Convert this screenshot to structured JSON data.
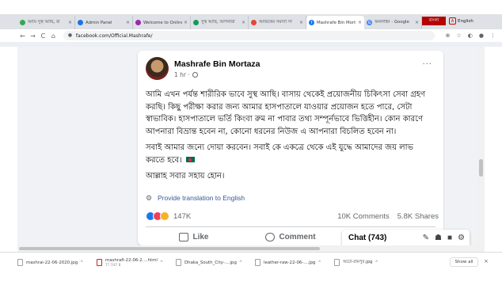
{
  "browser": {
    "tabs": [
      {
        "label": "আমি সুস্থ আছি, বা",
        "color": "#34a853"
      },
      {
        "label": "Admin Panel",
        "color": "#1a73e8"
      },
      {
        "label": "Welcome to OnlineNews",
        "color": "#9c27b0"
      },
      {
        "label": "সুস্থ আছি, আপনারা",
        "color": "#0f9d58"
      },
      {
        "label": "আজকের সমস্যা সা",
        "color": "#ea4335"
      },
      {
        "label": "Mashrafe Bin Mort",
        "color": "#1877f2",
        "active": true
      },
      {
        "label": "অনলাইন - Google",
        "color": "#4285f4"
      }
    ],
    "tab_close": "×",
    "new_tab": "+",
    "lang_badge": "বাংলা",
    "lang_icon": "A",
    "lang_label": "English",
    "nav": {
      "back": "←",
      "forward": "→",
      "reload": "C",
      "home": "⌂"
    },
    "url": "facebook.com/Official.Mashrafe/",
    "addr_icons": {
      "zoom": "⊕",
      "star": "☆",
      "ext": "◐",
      "account": "●",
      "menu": "⋮"
    }
  },
  "post": {
    "author": "Mashrafe Bin Mortaza",
    "time": "1 hr ·",
    "more": "···",
    "paragraphs": [
      "আমি এখন পর্যন্ত শারীরিক ভাবে সুস্থ আছি। বাসায় থেকেই প্রয়োজনীয় চিকিৎসা সেবা গ্রহণ করছি। কিছু পরীক্ষা করার জন্য আমার হাসপাতালে যাওয়ার প্রয়োজন হতে পারে, সেটা স্বাভাবিক। হাসপাতালে ভর্তি কিংবা রুম না পাবার তথ্য সম্পূর্নভাবে ভিত্তিহীন। কোন কারণে আপনারা বিভ্রান্ত হবেন না, কোনো ধরনের নিউজ এ আপনারা বিচলিত হবেন না।",
      "সবাই আমার জন্যে দোয়া করবেন। সবাই কে একত্রে থেকে এই যুদ্ধে আমাদের জয় লাভ করতে হবে।",
      "আল্লাহ সবার সহায় হোন।"
    ],
    "translate_label": "Provide translation to English",
    "reactions_count": "147K",
    "comments_count": "10K Comments",
    "shares_count": "5.8K Shares",
    "actions": {
      "like": "Like",
      "comment": "Comment"
    }
  },
  "chat": {
    "label": "Chat (743)",
    "icons": [
      "✎",
      "☗",
      "■",
      "⚙"
    ]
  },
  "downloads": {
    "items": [
      {
        "name": "mashrai-22-06-2020.jpg",
        "sub": ""
      },
      {
        "name": "mashrafi-22-06-2....html",
        "sub": "77.7/47 B"
      },
      {
        "name": "Dhaka_South_City-....jpg",
        "sub": ""
      },
      {
        "name": "leather-raw-22-06-....jpg",
        "sub": ""
      },
      {
        "name": "অটো-রামপুর.jpg",
        "sub": ""
      }
    ],
    "caret": "^",
    "show_all": "Show all",
    "close": "×"
  },
  "colors": {
    "fb_blue": "#1877f2",
    "link_blue": "#385898",
    "page_bg": "#f0f2f5"
  }
}
